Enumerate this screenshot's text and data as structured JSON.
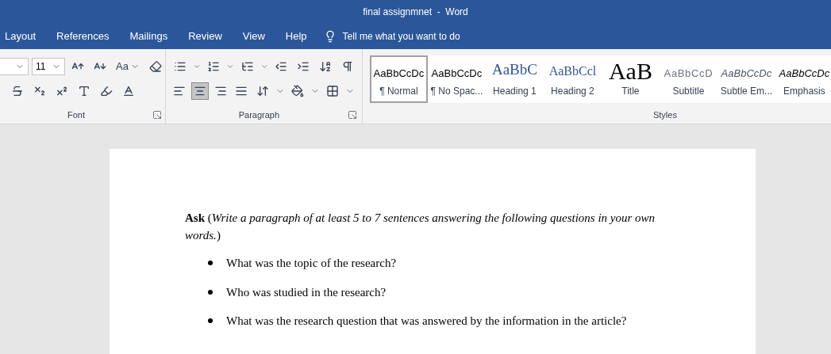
{
  "window": {
    "title": "final assignmnet  -  Word"
  },
  "tabs": [
    {
      "label": "Layout"
    },
    {
      "label": "References"
    },
    {
      "label": "Mailings"
    },
    {
      "label": "Review"
    },
    {
      "label": "View"
    },
    {
      "label": "Help"
    }
  ],
  "tell_me": {
    "placeholder": "Tell me what you want to do"
  },
  "font_group": {
    "label": "Font",
    "size": "11",
    "change_case": "Aa"
  },
  "paragraph_group": {
    "label": "Paragraph",
    "alignment": [
      {
        "kind": "left",
        "selected": false
      },
      {
        "kind": "center",
        "selected": true
      },
      {
        "kind": "right",
        "selected": false
      },
      {
        "kind": "justify",
        "selected": false
      }
    ]
  },
  "styles_group": {
    "label": "Styles",
    "styles": [
      {
        "kind": "normal",
        "preview": "AaBbCcDc",
        "label": "¶ Normal",
        "selected": true
      },
      {
        "kind": "nospacing",
        "preview": "AaBbCcDc",
        "label": "¶ No Spac...",
        "selected": false
      },
      {
        "kind": "heading1",
        "preview": "AaBbC",
        "label": "Heading 1",
        "selected": false
      },
      {
        "kind": "heading2",
        "preview": "AaBbCcl",
        "label": "Heading 2",
        "selected": false
      },
      {
        "kind": "title",
        "preview": "AaB",
        "label": "Title",
        "selected": false
      },
      {
        "kind": "subtitle",
        "preview": "AaBbCcD",
        "label": "Subtitle",
        "selected": false
      },
      {
        "kind": "subtle",
        "preview": "AaBbCcDc",
        "label": "Subtle Em...",
        "selected": false
      },
      {
        "kind": "emphasis",
        "preview": "AaBbCcDc",
        "label": "Emphasis",
        "selected": false
      }
    ]
  },
  "document": {
    "paragraph": "**Ask** (*Write a paragraph of at least 5 to 7 sentences answering the following questions in your own words.*)",
    "bullets": [
      "What was the topic of the research?",
      "Who was studied in the research?",
      "What was the research question that was answered by the information in the article?"
    ]
  }
}
